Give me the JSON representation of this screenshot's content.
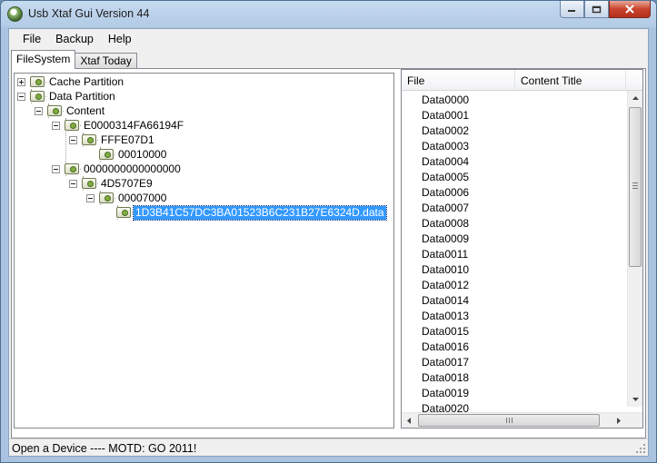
{
  "window": {
    "title": "Usb Xtaf Gui Version 44"
  },
  "menu": [
    {
      "label": "File"
    },
    {
      "label": "Backup"
    },
    {
      "label": "Help"
    }
  ],
  "tabs": [
    {
      "label": "FileSystem",
      "active": true
    },
    {
      "label": "Xtaf Today",
      "active": false
    }
  ],
  "tree": [
    {
      "label": "Cache Partition",
      "expander": "plus"
    },
    {
      "label": "Data Partition",
      "expander": "minus"
    },
    {
      "label": "Content",
      "expander": "minus"
    },
    {
      "label": "E0000314FA66194F",
      "expander": "minus"
    },
    {
      "label": "FFFE07D1",
      "expander": "minus"
    },
    {
      "label": "00010000",
      "expander": "none"
    },
    {
      "label": "0000000000000000",
      "expander": "minus"
    },
    {
      "label": "4D5707E9",
      "expander": "minus"
    },
    {
      "label": "00007000",
      "expander": "minus"
    },
    {
      "label": "1D3B41C57DC3BA01523B6C231B27E6324D.data",
      "expander": "none",
      "selected": true
    }
  ],
  "list": {
    "columns": [
      {
        "label": "File"
      },
      {
        "label": "Content Title"
      }
    ],
    "rows": [
      "Data0000",
      "Data0001",
      "Data0002",
      "Data0003",
      "Data0004",
      "Data0005",
      "Data0006",
      "Data0007",
      "Data0008",
      "Data0009",
      "Data0011",
      "Data0010",
      "Data0012",
      "Data0014",
      "Data0013",
      "Data0015",
      "Data0016",
      "Data0017",
      "Data0018",
      "Data0019",
      "Data0020"
    ]
  },
  "status": {
    "text": "Open a Device ---- MOTD: GO 2011!"
  },
  "colors": {
    "selection": "#3399ff",
    "titlebar": "#b3cbe6",
    "close_button": "#c9432e"
  }
}
